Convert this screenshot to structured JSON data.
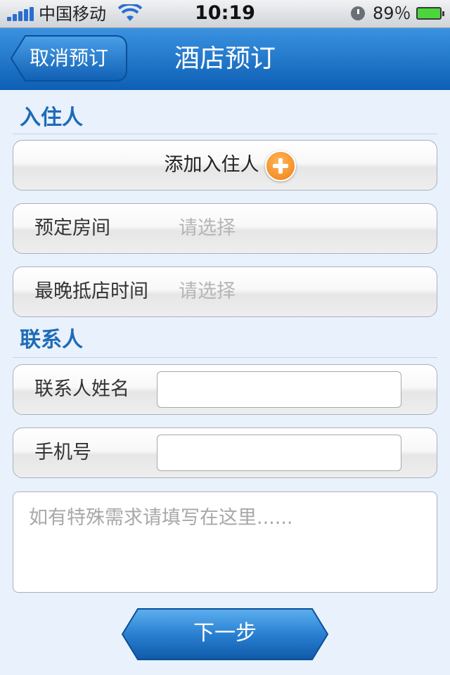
{
  "status_bar": {
    "carrier": "中国移动",
    "time": "10:19",
    "battery": "89％",
    "icons": [
      "signal-icon",
      "wifi-icon",
      "clock-icon",
      "battery-icon"
    ]
  },
  "nav": {
    "back_label": "取消预订",
    "title": "酒店预订"
  },
  "guests_section": {
    "heading": "入住人",
    "add_guest_label": "添加入住人",
    "add_icon": "plus-circle-icon",
    "rows": [
      {
        "label": "预定房间",
        "placeholder": "请选择"
      },
      {
        "label": "最晚抵店时间",
        "placeholder": "请选择"
      }
    ]
  },
  "contact_section": {
    "heading": "联系人",
    "name_label": "联系人姓名",
    "name_value": "",
    "phone_label": "手机号",
    "phone_value": ""
  },
  "notes": {
    "placeholder": "如有特殊需求请填写在这里......"
  },
  "next_button": "下一步",
  "colors": {
    "nav_blue": "#1a6fc4",
    "heading_blue": "#1e6bb8",
    "background": "#e9f1fc",
    "accent_orange": "#f08a1e"
  }
}
